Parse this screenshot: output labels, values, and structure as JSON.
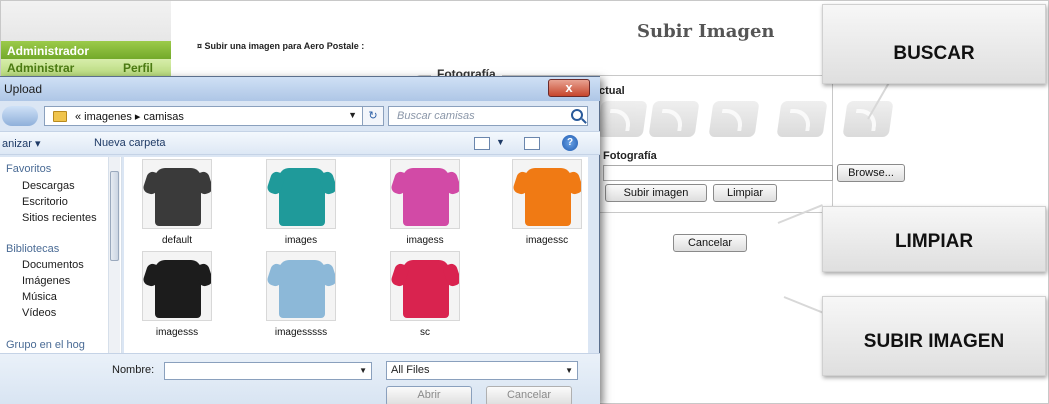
{
  "page": {
    "admin_title": "Administrador",
    "admin_link": "Administrar",
    "profile_link": "Perfil",
    "subtitle": "¤ Subir una imagen para Aero Postale :",
    "heading": "Subir Imagen",
    "fieldset_legend": "Fotografía",
    "current_label": "ctual",
    "photo_label": "Fotografía",
    "browse_label": "Browse...",
    "upload_label": "Subir imagen",
    "clear_label": "Limpiar",
    "cancel_label": "Cancelar"
  },
  "callouts": {
    "search": "BUSCAR",
    "clear": "LIMPIAR",
    "upload": "SUBIR IMAGEN"
  },
  "dialog": {
    "title": "Upload",
    "close_label": "x",
    "address": "« imagenes ▸ camisas",
    "search_placeholder": "Buscar camisas",
    "refresh_label": "↻",
    "organize_label": "anizar ▾",
    "new_folder_label": "Nueva carpeta",
    "help_label": "?",
    "nav": [
      {
        "label": "Favoritos",
        "section": true
      },
      {
        "label": "Descargas"
      },
      {
        "label": "Escritorio"
      },
      {
        "label": "Sitios recientes"
      },
      {
        "label": "Bibliotecas",
        "section": true
      },
      {
        "label": "Documentos"
      },
      {
        "label": "Imágenes"
      },
      {
        "label": "Música"
      },
      {
        "label": "Vídeos"
      },
      {
        "label": "Grupo en el hog",
        "section": true
      }
    ],
    "files": [
      {
        "name": "default",
        "color": "#3a3a3a"
      },
      {
        "name": "images",
        "color": "#1f9a9a"
      },
      {
        "name": "imagess",
        "color": "#d24aa6"
      },
      {
        "name": "imagessc",
        "color": "#f07a14"
      },
      {
        "name": "imagesss",
        "color": "#1c1c1c"
      },
      {
        "name": "imagesssss",
        "color": "#8cb8d8"
      },
      {
        "name": "sc",
        "color": "#d9234f"
      }
    ],
    "filename_label": "Nombre:",
    "filename_value": "",
    "filetype_value": "All Files",
    "open_label": "Abrir",
    "cancel_label": "Cancelar"
  }
}
